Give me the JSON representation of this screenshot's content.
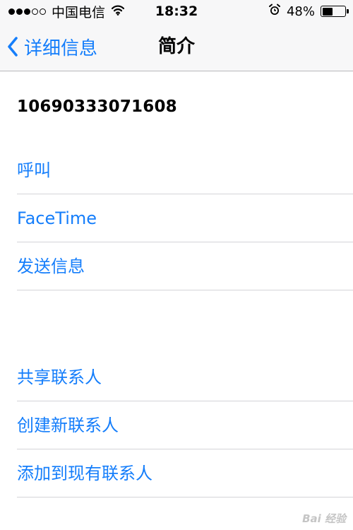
{
  "status_bar": {
    "carrier": "中国电信",
    "time": "18:32",
    "battery_percent": "48%",
    "battery_level": 0.48,
    "signal_bars_filled": 3,
    "signal_bars_total": 5,
    "icons": [
      "wifi-icon",
      "alarm-clock-icon",
      "battery-icon"
    ]
  },
  "nav": {
    "back_label": "详细信息",
    "title": "简介"
  },
  "contact": {
    "phone_number": "10690333071608"
  },
  "actions": [
    {
      "label": "呼叫"
    },
    {
      "label": "FaceTime"
    },
    {
      "label": "发送信息"
    }
  ],
  "contact_actions": [
    {
      "label": "共享联系人"
    },
    {
      "label": "创建新联系人"
    },
    {
      "label": "添加到现有联系人"
    }
  ],
  "watermark": {
    "text": "Bai 经验"
  },
  "colors": {
    "accent": "#157efb",
    "bar_background": "#f7f7f8",
    "separator": "#d4d4d8"
  }
}
